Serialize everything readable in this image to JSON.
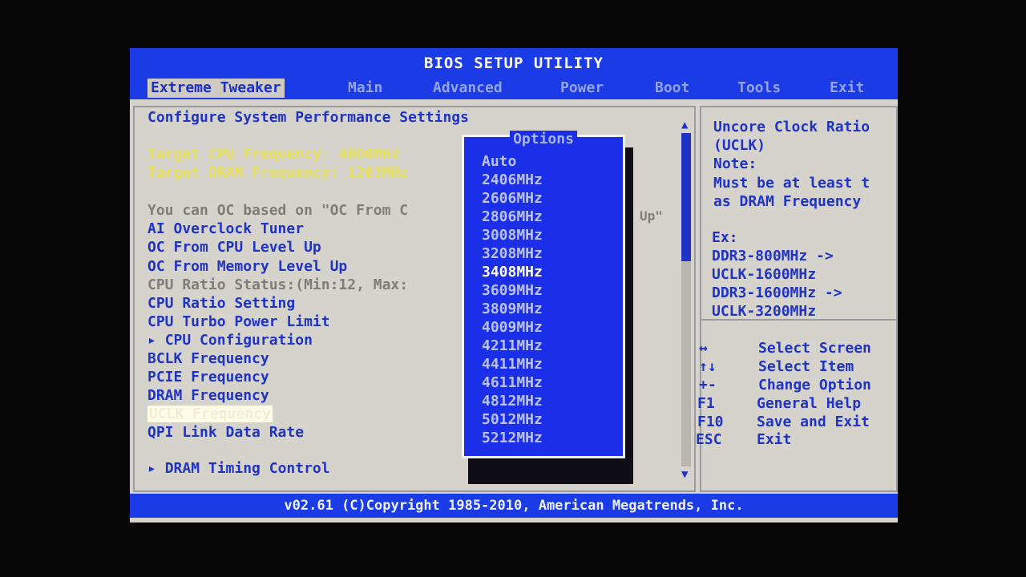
{
  "app_title": "BIOS SETUP UTILITY",
  "tabs": [
    "Extreme Tweaker",
    "Main",
    "Advanced",
    "Power",
    "Boot",
    "Tools",
    "Exit"
  ],
  "section_title": "Configure System Performance Settings",
  "target_cpu": "Target CPU Frequency: 4000MHz",
  "target_dram": "Target DRAM Frequency: 1203MHz",
  "oc_hint": "You can OC based on \"OC From C",
  "oc_hint_tail": "Up\"",
  "menu": {
    "ai_overclock": "AI Overclock Tuner",
    "oc_cpu": "OC From CPU Level Up",
    "oc_memory": "OC From Memory Level Up",
    "cpu_ratio_status": "CPU Ratio Status:(Min:12, Max:",
    "cpu_ratio": "CPU Ratio Setting",
    "cpu_turbo": "CPU Turbo Power Limit",
    "cpu_config": "CPU Configuration",
    "bclk": "BCLK Frequency",
    "pcie": "PCIE Frequency",
    "dram": "DRAM Frequency",
    "uclk": "UCLK Frequency",
    "qpi": "QPI Link Data Rate",
    "dram_timing": "DRAM Timing Control"
  },
  "options": {
    "title": "Options",
    "items": [
      "Auto",
      "2406MHz",
      "2606MHz",
      "2806MHz",
      "3008MHz",
      "3208MHz",
      "3408MHz",
      "3609MHz",
      "3809MHz",
      "4009MHz",
      "4211MHz",
      "4411MHz",
      "4611MHz",
      "4812MHz",
      "5012MHz",
      "5212MHz"
    ],
    "selected": "3408MHz"
  },
  "help": {
    "lines": [
      "Uncore Clock Ratio",
      "(UCLK)",
      "Note:",
      "Must be at least t",
      "as DRAM Frequency"
    ],
    "ex_title": "Ex:",
    "ex_lines": [
      "DDR3-800MHz ->",
      "UCLK-1600MHz",
      "DDR3-1600MHz ->",
      "UCLK-3200MHz"
    ]
  },
  "keys": [
    {
      "key": "↔",
      "action": "Select Screen"
    },
    {
      "key": "↑↓",
      "action": "Select Item"
    },
    {
      "key": "+-",
      "action": "Change Option"
    },
    {
      "key": "F1",
      "action": "General Help"
    },
    {
      "key": "F10",
      "action": "Save and Exit"
    },
    {
      "key": "ESC",
      "action": "Exit"
    }
  ],
  "footer": "v02.61 (C)Copyright 1985-2010, American Megatrends, Inc.",
  "colors": {
    "bar": "#1a3be6",
    "text": "#1f33c4",
    "yellow": "#e7e15a",
    "popup": "#1c2fe8"
  }
}
